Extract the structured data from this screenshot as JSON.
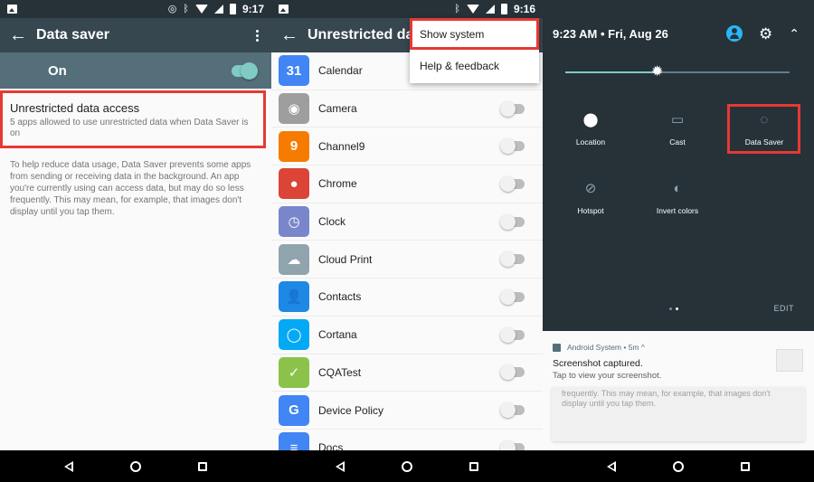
{
  "panel1": {
    "status_time": "9:17",
    "title": "Data saver",
    "master_label": "On",
    "master_on": true,
    "access_title": "Unrestricted data access",
    "access_subtitle": "5 apps allowed to use unrestricted data when Data Saver is on",
    "description": "To help reduce data usage, Data Saver prevents some apps from sending or receiving data in the background. An app you're currently using can access data, but may do so less frequently. This may mean, for example, that images don't display until you tap them."
  },
  "panel2": {
    "status_time": "9:16",
    "title": "Unrestricted data",
    "menu": [
      {
        "label": "Show system"
      },
      {
        "label": "Help & feedback"
      }
    ],
    "apps": [
      {
        "name": "Calendar",
        "icon": "calendar-icon",
        "glyph": "31",
        "color": "#4285f4",
        "enabled": false
      },
      {
        "name": "Camera",
        "icon": "camera-icon",
        "glyph": "◉",
        "color": "#9e9e9e",
        "enabled": false
      },
      {
        "name": "Channel9",
        "icon": "channel9-icon",
        "glyph": "9",
        "color": "#f57c00",
        "enabled": false
      },
      {
        "name": "Chrome",
        "icon": "chrome-icon",
        "glyph": "●",
        "color": "#db4437",
        "enabled": false
      },
      {
        "name": "Clock",
        "icon": "clock-icon",
        "glyph": "◷",
        "color": "#7986cb",
        "enabled": false
      },
      {
        "name": "Cloud Print",
        "icon": "cloud-print-icon",
        "glyph": "☁",
        "color": "#90a4ae",
        "enabled": false
      },
      {
        "name": "Contacts",
        "icon": "contacts-icon",
        "glyph": "👤",
        "color": "#1e88e5",
        "enabled": false
      },
      {
        "name": "Cortana",
        "icon": "cortana-icon",
        "glyph": "◯",
        "color": "#03a9f4",
        "enabled": false
      },
      {
        "name": "CQATest",
        "icon": "cqatest-icon",
        "glyph": "✓",
        "color": "#8bc34a",
        "enabled": false
      },
      {
        "name": "Device Policy",
        "icon": "device-policy-icon",
        "glyph": "G",
        "color": "#4285f4",
        "enabled": false
      },
      {
        "name": "Docs",
        "icon": "docs-icon",
        "glyph": "≡",
        "color": "#4285f4",
        "enabled": false
      }
    ]
  },
  "panel3": {
    "datetime": "9:23 AM • Fri, Aug 26",
    "brightness_fraction": 0.41,
    "tiles": [
      {
        "label": "Location",
        "icon": "location-icon",
        "glyph": "⬤",
        "dim": false
      },
      {
        "label": "Cast",
        "icon": "cast-icon",
        "glyph": "▭",
        "dim": true
      },
      {
        "label": "Data Saver",
        "icon": "data-saver-icon",
        "glyph": "◌",
        "dim": true
      },
      {
        "label": "Hotspot",
        "icon": "hotspot-icon",
        "glyph": "⊘",
        "dim": true
      },
      {
        "label": "Invert colors",
        "icon": "invert-colors-icon",
        "glyph": "◐",
        "dim": true
      }
    ],
    "edit_label": "EDIT",
    "notification": {
      "source": "Android System • 5m ^",
      "title": "Screenshot captured.",
      "subtitle": "Tap to view your screenshot.",
      "preview_text": "frequently. This may mean, for example, that images don't display until you tap them."
    }
  },
  "colors": {
    "toolbar": "#37474f",
    "accent": "#80cbc4",
    "highlight": "#e53935"
  }
}
